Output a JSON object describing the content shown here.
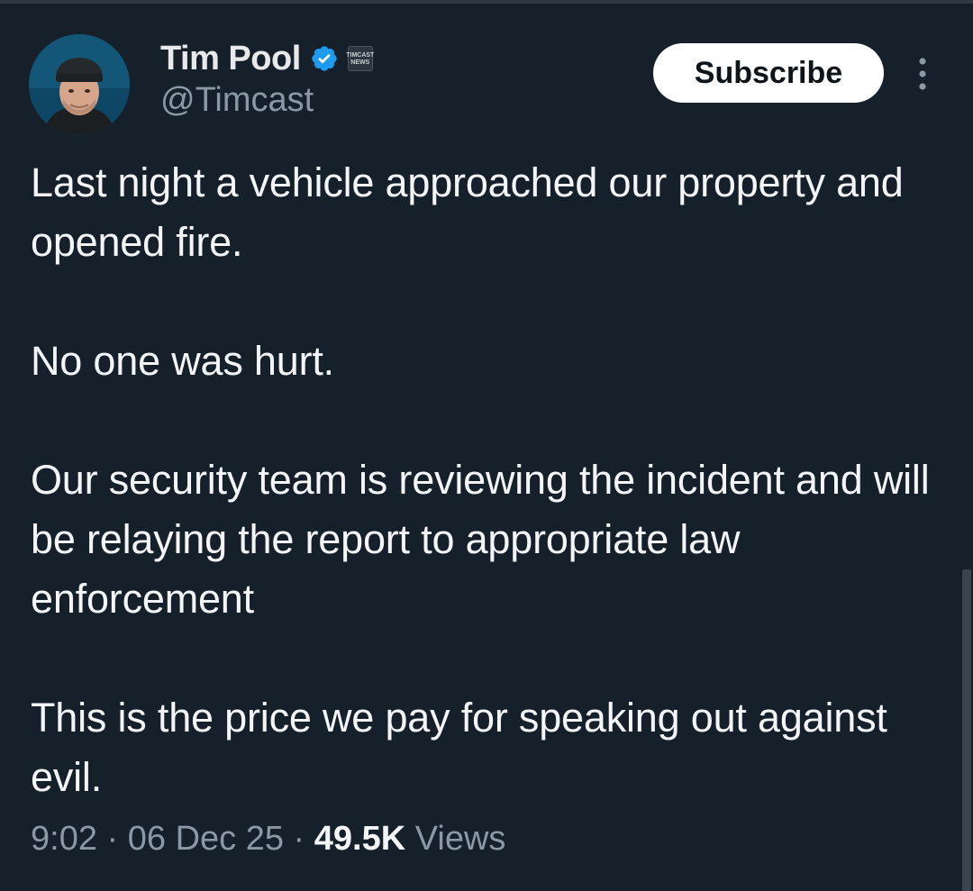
{
  "author": {
    "display_name": "Tim Pool",
    "handle": "@Timcast",
    "avatar_icon": "avatar-image",
    "verified_icon": "verified-badge-icon",
    "affiliate_badge": {
      "line1": "TIMCAST",
      "line2": "NEWS"
    }
  },
  "actions": {
    "subscribe_label": "Subscribe",
    "more_icon": "more-vertical-icon"
  },
  "tweet": {
    "paragraphs": [
      "Last night a vehicle approached our property and opened fire.",
      "No one was hurt.",
      "Our security team is reviewing the incident and will be relaying the report to appropriate law enforcement",
      "This is the price we pay for speaking out against evil."
    ]
  },
  "meta": {
    "time": "9:02",
    "separator": "·",
    "date": "06 Dec 25",
    "views_count": "49.5K",
    "views_label": "Views"
  },
  "colors": {
    "background": "#16202b",
    "text": "#e7e9ea",
    "secondary_text": "#8b98a5",
    "verified_blue": "#1d9bf0",
    "button_bg": "#ffffff"
  }
}
